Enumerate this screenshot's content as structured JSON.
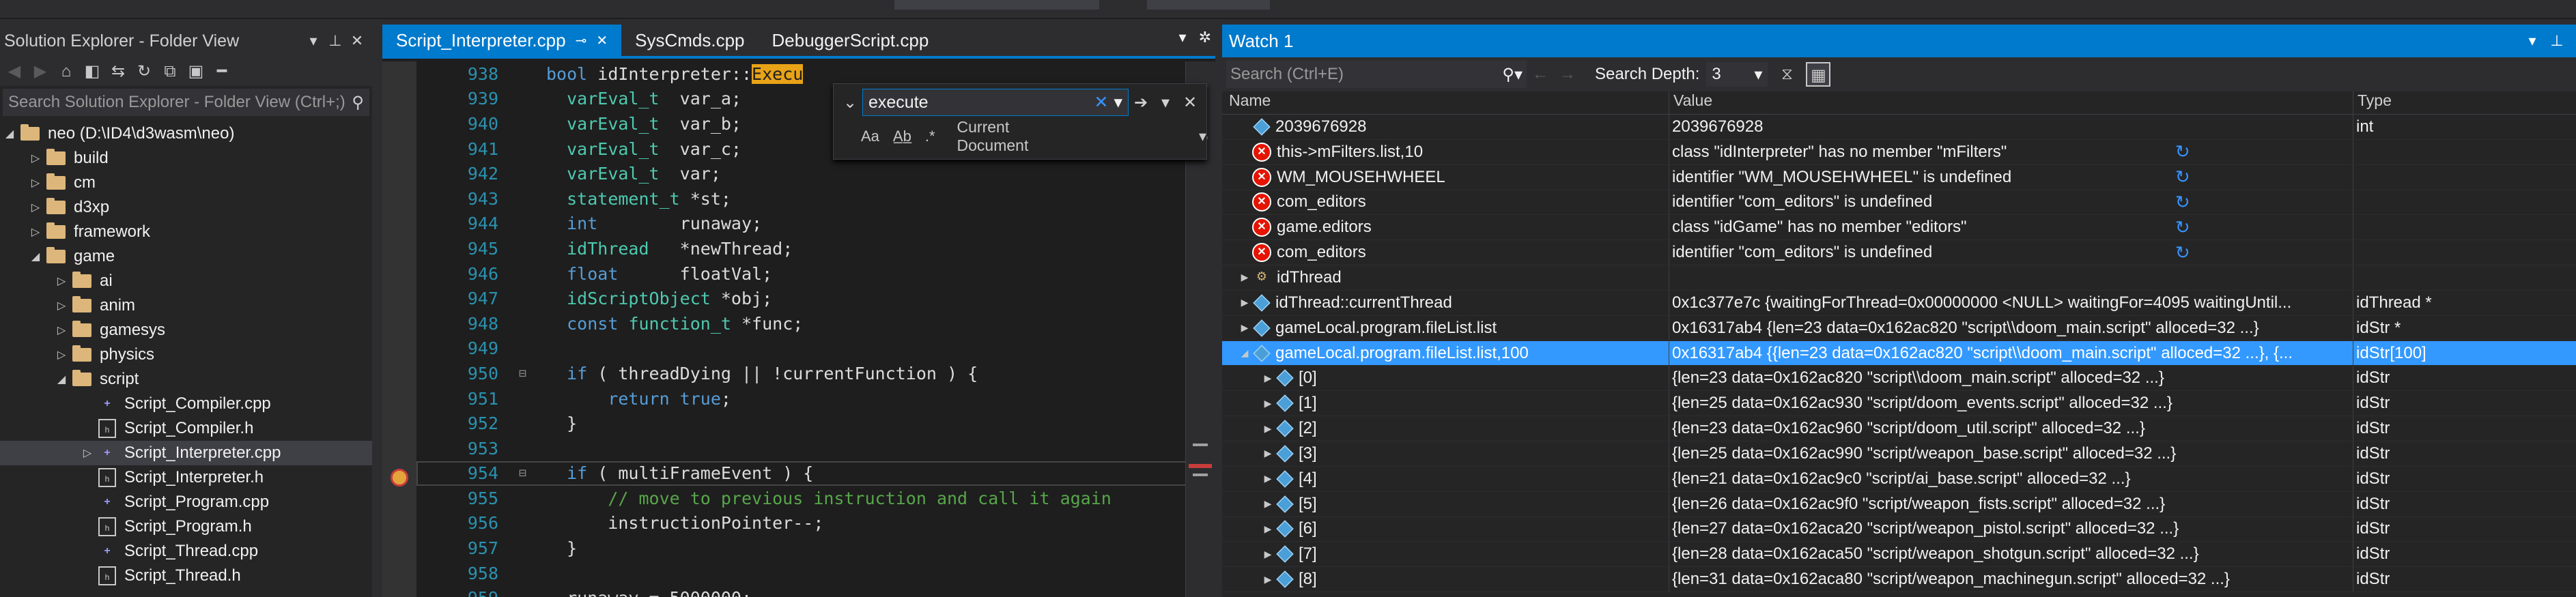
{
  "solution_explorer": {
    "title": "Solution Explorer - Folder View",
    "search_placeholder": "Search Solution Explorer - Folder View (Ctrl+;)",
    "root": "neo (D:\\ID4\\d3wasm\\neo)",
    "items": [
      {
        "label": "build",
        "type": "folder",
        "depth": 1
      },
      {
        "label": "cm",
        "type": "folder",
        "depth": 1
      },
      {
        "label": "d3xp",
        "type": "folder",
        "depth": 1
      },
      {
        "label": "framework",
        "type": "folder",
        "depth": 1
      },
      {
        "label": "game",
        "type": "folder",
        "depth": 1,
        "open": true
      },
      {
        "label": "ai",
        "type": "folder",
        "depth": 2
      },
      {
        "label": "anim",
        "type": "folder",
        "depth": 2
      },
      {
        "label": "gamesys",
        "type": "folder",
        "depth": 2
      },
      {
        "label": "physics",
        "type": "folder",
        "depth": 2
      },
      {
        "label": "script",
        "type": "folder",
        "depth": 2,
        "open": true
      },
      {
        "label": "Script_Compiler.cpp",
        "type": "cpp",
        "depth": 3
      },
      {
        "label": "Script_Compiler.h",
        "type": "h",
        "depth": 3
      },
      {
        "label": "Script_Interpreter.cpp",
        "type": "cpp",
        "depth": 3,
        "selected": true
      },
      {
        "label": "Script_Interpreter.h",
        "type": "h",
        "depth": 3
      },
      {
        "label": "Script_Program.cpp",
        "type": "cpp",
        "depth": 3
      },
      {
        "label": "Script_Program.h",
        "type": "h",
        "depth": 3
      },
      {
        "label": "Script_Thread.cpp",
        "type": "cpp",
        "depth": 3
      },
      {
        "label": "Script_Thread.h",
        "type": "h",
        "depth": 3
      }
    ]
  },
  "editor": {
    "tabs": [
      "Script_Interpreter.cpp",
      "SysCmds.cpp",
      "DebuggerScript.cpp"
    ],
    "active_tab": 0,
    "find": {
      "value": "execute",
      "scope": "Current Document"
    }
  },
  "code_lines": [
    {
      "n": "938",
      "html": "<span class='kw'>bool</span> idInterpreter::<span style='background:#e8a317;color:#1e1e1e'>Execu</span>"
    },
    {
      "n": "939",
      "html": "  <span class='ty'>varEval_t</span>  var_a;"
    },
    {
      "n": "940",
      "html": "  <span class='ty'>varEval_t</span>  var_b;"
    },
    {
      "n": "941",
      "html": "  <span class='ty'>varEval_t</span>  var_c;"
    },
    {
      "n": "942",
      "html": "  <span class='ty'>varEval_t</span>  var;"
    },
    {
      "n": "943",
      "html": "  <span class='ty'>statement_t</span> *st;"
    },
    {
      "n": "944",
      "html": "  <span class='kw'>int</span>        runaway;"
    },
    {
      "n": "945",
      "html": "  <span class='ty'>idThread</span>   *newThread;"
    },
    {
      "n": "946",
      "html": "  <span class='kw'>float</span>      floatVal;"
    },
    {
      "n": "947",
      "html": "  <span class='ty'>idScriptObject</span> *obj;"
    },
    {
      "n": "948",
      "html": "  <span class='kw'>const</span> <span class='ty'>function_t</span> *func;"
    },
    {
      "n": "949",
      "html": ""
    },
    {
      "n": "950",
      "html": "  <span class='kw'>if</span> ( threadDying || !currentFunction ) {"
    },
    {
      "n": "951",
      "html": "      <span class='kw'>return</span> <span class='kw'>true</span>;"
    },
    {
      "n": "952",
      "html": "  }"
    },
    {
      "n": "953",
      "html": ""
    },
    {
      "n": "954",
      "html": "  <span class='kw'>if</span> ( multiFrameEvent ) {"
    },
    {
      "n": "955",
      "html": "      <span class='cm'>// move to previous instruction and call it again</span>"
    },
    {
      "n": "956",
      "html": "      instructionPointer--;"
    },
    {
      "n": "957",
      "html": "  }"
    },
    {
      "n": "958",
      "html": ""
    },
    {
      "n": "959",
      "html": "  runaway = 5000000;"
    }
  ],
  "watch": {
    "title": "Watch 1",
    "search_placeholder": "Search (Ctrl+E)",
    "depth_label": "Search Depth:",
    "depth_value": "3",
    "columns": [
      "Name",
      "Value",
      "Type"
    ],
    "rows": [
      {
        "icon": "obj",
        "exp": "",
        "name": "2039676928",
        "value": "2039676928",
        "type": "int"
      },
      {
        "icon": "err",
        "exp": "",
        "name": "this->mFilters.list,10",
        "value": "class \"idInterpreter\" has no member \"mFilters\"",
        "type": "",
        "refresh": true
      },
      {
        "icon": "err",
        "exp": "",
        "name": "WM_MOUSEHWHEEL",
        "value": "identifier \"WM_MOUSEHWHEEL\" is undefined",
        "type": "",
        "refresh": true
      },
      {
        "icon": "err",
        "exp": "",
        "name": "com_editors",
        "value": "identifier \"com_editors\" is undefined",
        "type": "",
        "refresh": true
      },
      {
        "icon": "err",
        "exp": "",
        "name": "game.editors",
        "value": "class \"idGame\" has no member \"editors\"",
        "type": "",
        "refresh": true
      },
      {
        "icon": "err",
        "exp": "",
        "name": "com_editors",
        "value": "identifier \"com_editors\" is undefined",
        "type": "",
        "refresh": true
      },
      {
        "icon": "cls",
        "exp": "▶",
        "name": "idThread",
        "value": "",
        "type": ""
      },
      {
        "icon": "obj",
        "exp": "▶",
        "name": "idThread::currentThread",
        "value": "0x1c377e7c {waitingForThread=0x00000000 <NULL> waitingFor=4095 waitingUntil...",
        "type": "idThread *"
      },
      {
        "icon": "obj",
        "exp": "▶",
        "name": "gameLocal.program.fileList.list",
        "value": "0x16317ab4 {len=23 data=0x162ac820 \"script\\\\doom_main.script\" alloced=32 ...}",
        "type": "idStr *"
      },
      {
        "icon": "obj",
        "exp": "◢",
        "name": "gameLocal.program.fileList.list,100",
        "value": "0x16317ab4 {{len=23 data=0x162ac820 \"script\\\\doom_main.script\" alloced=32 ...}, {...",
        "type": "idStr[100]",
        "selected": true
      },
      {
        "icon": "obj",
        "exp": "▶",
        "name": "[0]",
        "value": "{len=23 data=0x162ac820 \"script\\\\doom_main.script\" alloced=32 ...}",
        "type": "idStr",
        "child": true
      },
      {
        "icon": "obj",
        "exp": "▶",
        "name": "[1]",
        "value": "{len=25 data=0x162ac930 \"script/doom_events.script\" alloced=32 ...}",
        "type": "idStr",
        "child": true
      },
      {
        "icon": "obj",
        "exp": "▶",
        "name": "[2]",
        "value": "{len=23 data=0x162ac960 \"script/doom_util.script\" alloced=32 ...}",
        "type": "idStr",
        "child": true
      },
      {
        "icon": "obj",
        "exp": "▶",
        "name": "[3]",
        "value": "{len=25 data=0x162ac990 \"script/weapon_base.script\" alloced=32 ...}",
        "type": "idStr",
        "child": true
      },
      {
        "icon": "obj",
        "exp": "▶",
        "name": "[4]",
        "value": "{len=21 data=0x162ac9c0 \"script/ai_base.script\" alloced=32 ...}",
        "type": "idStr",
        "child": true
      },
      {
        "icon": "obj",
        "exp": "▶",
        "name": "[5]",
        "value": "{len=26 data=0x162ac9f0 \"script/weapon_fists.script\" alloced=32 ...}",
        "type": "idStr",
        "child": true
      },
      {
        "icon": "obj",
        "exp": "▶",
        "name": "[6]",
        "value": "{len=27 data=0x162aca20 \"script/weapon_pistol.script\" alloced=32 ...}",
        "type": "idStr",
        "child": true
      },
      {
        "icon": "obj",
        "exp": "▶",
        "name": "[7]",
        "value": "{len=28 data=0x162aca50 \"script/weapon_shotgun.script\" alloced=32 ...}",
        "type": "idStr",
        "child": true
      },
      {
        "icon": "obj",
        "exp": "▶",
        "name": "[8]",
        "value": "{len=31 data=0x162aca80 \"script/weapon_machinegun.script\" alloced=32 ...}",
        "type": "idStr",
        "child": true
      }
    ]
  }
}
